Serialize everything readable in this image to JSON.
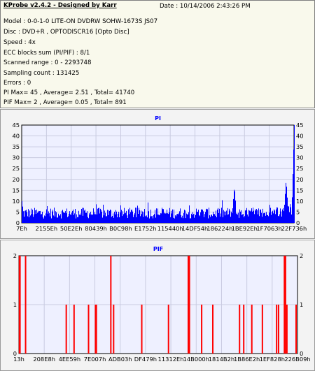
{
  "header": {
    "app_title": "KProbe v2.4.2 - Designed by Karr",
    "date": "Date : 10/14/2006 2:43:26 PM"
  },
  "info_lines": [
    "Model : 0-0-1-0 LITE-ON DVDRW SOHW-1673S JS07",
    "Disc : DVD+R , OPTODISCR16 [Opto Disc]",
    "Speed : 4x",
    "ECC blocks sum (PI/PIF) : 8/1",
    "Scanned range : 0 - 2293748",
    "Sampling count : 131425",
    "Errors : 0",
    "PI Max= 45 , Average= 2.51 , Total= 41740",
    "PIF Max= 2 , Average= 0.05 , Total= 891"
  ],
  "colors": {
    "bar": "#0000ff",
    "pif_bar": "#ff0000",
    "plot_bg": "#eef0ff",
    "info_bg": "#f9f9ec",
    "title": "#0000ff"
  },
  "chart_data": [
    {
      "type": "bar",
      "title": "PI",
      "ylim": [
        0,
        45
      ],
      "y_ticks": [
        0,
        5,
        10,
        15,
        20,
        25,
        30,
        35,
        40,
        45
      ],
      "x_tick_labels": [
        "7Eh",
        "2155Eh",
        "50E2Eh",
        "80439h",
        "B0C98h",
        "E1752h",
        "115440h",
        "14DF54h",
        "186224h",
        "1BE92Eh",
        "1F7063h",
        "22F736h"
      ],
      "grid": true,
      "notable_values": [
        {
          "position": 0.0,
          "value": 10
        },
        {
          "position": 0.78,
          "value": 17
        },
        {
          "position": 0.97,
          "value": 20
        },
        {
          "position": 1.0,
          "value": 45
        }
      ],
      "baseline_range": [
        2,
        7
      ]
    },
    {
      "type": "bar",
      "title": "PIF",
      "ylim": [
        0,
        2
      ],
      "y_ticks": [
        0,
        1,
        2
      ],
      "x_tick_labels": [
        "13h",
        "208E8h",
        "4EE59h",
        "7E007h",
        "ADB03h",
        "DF479h",
        "11312Eh",
        "14B000h",
        "1814B2h",
        "1B86E2h",
        "1EF828h",
        "226B09h"
      ],
      "grid": true,
      "spikes": [
        {
          "position": 0.002,
          "value": 2
        },
        {
          "position": 0.004,
          "value": 2
        },
        {
          "position": 0.024,
          "value": 2
        },
        {
          "position": 0.17,
          "value": 1
        },
        {
          "position": 0.198,
          "value": 1
        },
        {
          "position": 0.25,
          "value": 1
        },
        {
          "position": 0.275,
          "value": 1
        },
        {
          "position": 0.278,
          "value": 1
        },
        {
          "position": 0.33,
          "value": 2
        },
        {
          "position": 0.34,
          "value": 1
        },
        {
          "position": 0.441,
          "value": 1
        },
        {
          "position": 0.537,
          "value": 1
        },
        {
          "position": 0.608,
          "value": 2
        },
        {
          "position": 0.612,
          "value": 2
        },
        {
          "position": 0.656,
          "value": 1
        },
        {
          "position": 0.696,
          "value": 1
        },
        {
          "position": 0.792,
          "value": 1
        },
        {
          "position": 0.807,
          "value": 1
        },
        {
          "position": 0.836,
          "value": 1
        },
        {
          "position": 0.874,
          "value": 1
        },
        {
          "position": 0.925,
          "value": 1
        },
        {
          "position": 0.932,
          "value": 1
        },
        {
          "position": 0.953,
          "value": 2
        },
        {
          "position": 0.957,
          "value": 2
        },
        {
          "position": 0.962,
          "value": 1
        },
        {
          "position": 0.995,
          "value": 1
        }
      ]
    }
  ]
}
